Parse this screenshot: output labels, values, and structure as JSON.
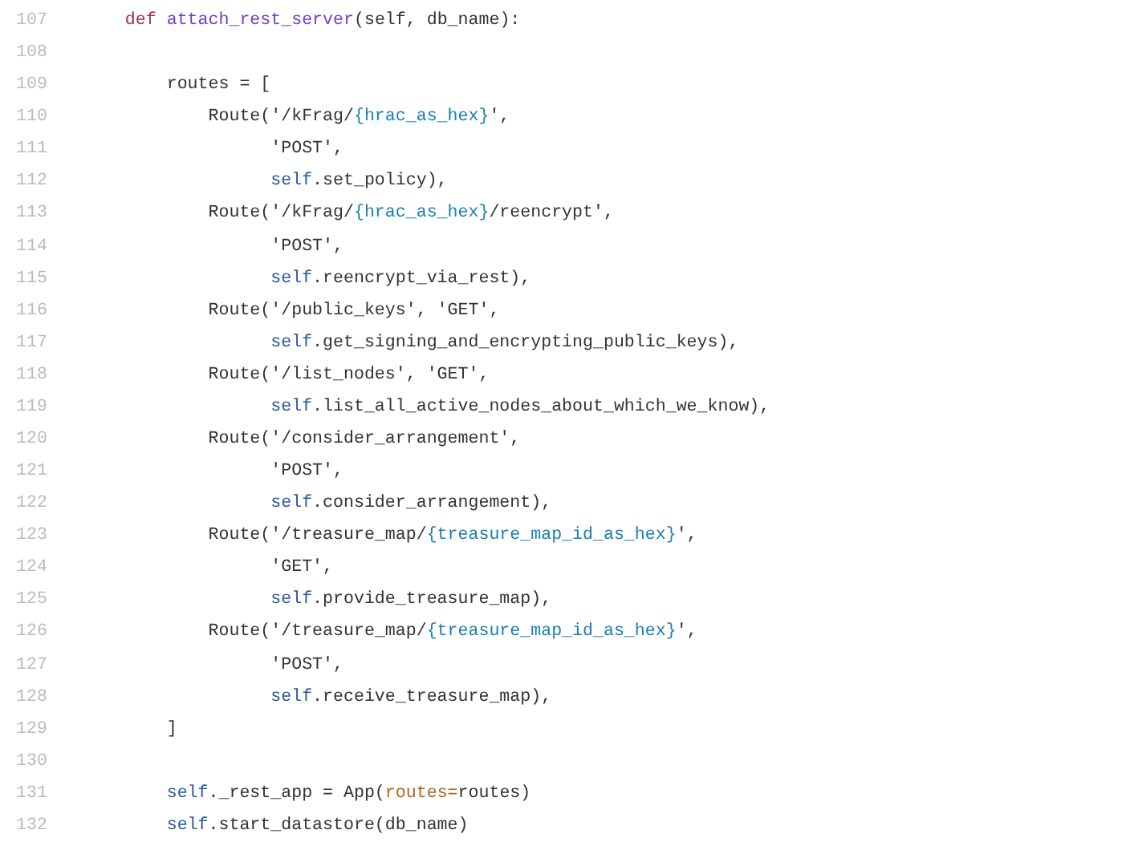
{
  "code_lines": [
    {
      "number": "107",
      "tokens": [
        {
          "kind": "keyword",
          "text": "    def "
        },
        {
          "kind": "function",
          "text": "attach_rest_server"
        },
        {
          "kind": "plain",
          "text": "(self, db_name):"
        }
      ]
    },
    {
      "number": "108"
    },
    {
      "number": "109",
      "tokens": [
        {
          "kind": "plain",
          "text": "        routes = ["
        }
      ]
    },
    {
      "number": "110",
      "tokens": [
        {
          "kind": "plain",
          "text": "            Route('/kFrag/"
        },
        {
          "kind": "interp",
          "text": "{hrac_as_hex}"
        },
        {
          "kind": "plain",
          "text": "',"
        }
      ]
    },
    {
      "number": "111",
      "tokens": [
        {
          "kind": "plain",
          "text": "                  'POST',"
        }
      ]
    },
    {
      "number": "112",
      "tokens": [
        {
          "kind": "self",
          "text": "                  self"
        },
        {
          "kind": "plain",
          "text": ".set_policy),"
        }
      ]
    },
    {
      "number": "113",
      "tokens": [
        {
          "kind": "plain",
          "text": "            Route('/kFrag/"
        },
        {
          "kind": "interp",
          "text": "{hrac_as_hex}"
        },
        {
          "kind": "plain",
          "text": "/reencrypt',"
        }
      ]
    },
    {
      "number": "114",
      "tokens": [
        {
          "kind": "plain",
          "text": "                  'POST',"
        }
      ]
    },
    {
      "number": "115",
      "tokens": [
        {
          "kind": "self",
          "text": "                  self"
        },
        {
          "kind": "plain",
          "text": ".reencrypt_via_rest),"
        }
      ]
    },
    {
      "number": "116",
      "tokens": [
        {
          "kind": "plain",
          "text": "            Route('/public_keys', 'GET',"
        }
      ]
    },
    {
      "number": "117",
      "tokens": [
        {
          "kind": "self",
          "text": "                  self"
        },
        {
          "kind": "plain",
          "text": ".get_signing_and_encrypting_public_keys),"
        }
      ]
    },
    {
      "number": "118",
      "tokens": [
        {
          "kind": "plain",
          "text": "            Route('/list_nodes', 'GET',"
        }
      ]
    },
    {
      "number": "119",
      "tokens": [
        {
          "kind": "self",
          "text": "                  self"
        },
        {
          "kind": "plain",
          "text": ".list_all_active_nodes_about_which_we_know),"
        }
      ]
    },
    {
      "number": "120",
      "tokens": [
        {
          "kind": "plain",
          "text": "            Route('/consider_arrangement',"
        }
      ]
    },
    {
      "number": "121",
      "tokens": [
        {
          "kind": "plain",
          "text": "                  'POST',"
        }
      ]
    },
    {
      "number": "122",
      "tokens": [
        {
          "kind": "self",
          "text": "                  self"
        },
        {
          "kind": "plain",
          "text": ".consider_arrangement),"
        }
      ]
    },
    {
      "number": "123",
      "tokens": [
        {
          "kind": "plain",
          "text": "            Route('/treasure_map/"
        },
        {
          "kind": "interp",
          "text": "{treasure_map_id_as_hex}"
        },
        {
          "kind": "plain",
          "text": "',"
        }
      ]
    },
    {
      "number": "124",
      "tokens": [
        {
          "kind": "plain",
          "text": "                  'GET',"
        }
      ]
    },
    {
      "number": "125",
      "tokens": [
        {
          "kind": "self",
          "text": "                  self"
        },
        {
          "kind": "plain",
          "text": ".provide_treasure_map),"
        }
      ]
    },
    {
      "number": "126",
      "tokens": [
        {
          "kind": "plain",
          "text": "            Route('/treasure_map/"
        },
        {
          "kind": "interp",
          "text": "{treasure_map_id_as_hex}"
        },
        {
          "kind": "plain",
          "text": "',"
        }
      ]
    },
    {
      "number": "127",
      "tokens": [
        {
          "kind": "plain",
          "text": "                  'POST',"
        }
      ]
    },
    {
      "number": "128",
      "tokens": [
        {
          "kind": "self",
          "text": "                  self"
        },
        {
          "kind": "plain",
          "text": ".receive_treasure_map),"
        }
      ]
    },
    {
      "number": "129",
      "tokens": [
        {
          "kind": "plain",
          "text": "        ]"
        }
      ]
    },
    {
      "number": "130"
    },
    {
      "number": "131",
      "tokens": [
        {
          "kind": "self",
          "text": "        self"
        },
        {
          "kind": "plain",
          "text": "._rest_app = App("
        },
        {
          "kind": "kwarg",
          "text": "routes="
        },
        {
          "kind": "plain",
          "text": "routes)"
        }
      ]
    },
    {
      "number": "132",
      "tokens": [
        {
          "kind": "self",
          "text": "        self"
        },
        {
          "kind": "plain",
          "text": ".start_datastore(db_name)"
        }
      ]
    }
  ]
}
